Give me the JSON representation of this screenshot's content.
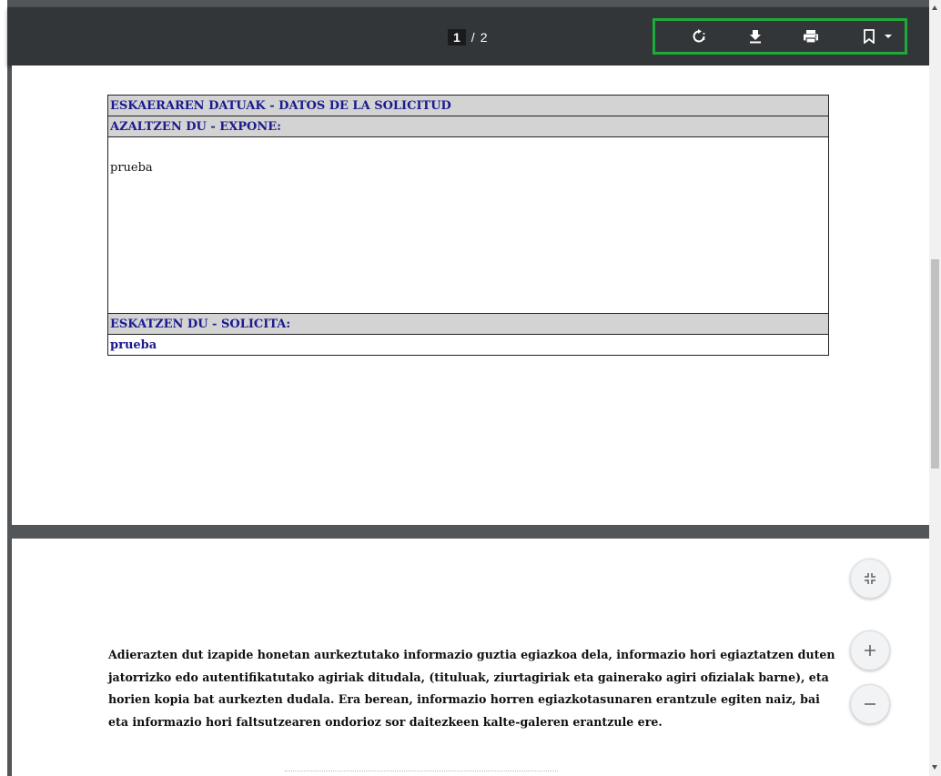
{
  "toolbar": {
    "page_current": "1",
    "page_separator": "/",
    "page_total": "2",
    "icons": {
      "rotate": "rotate-icon",
      "download": "download-icon",
      "print": "print-icon",
      "bookmark": "bookmark-icon",
      "dropdown": "chevron-down-icon"
    },
    "highlight_color": "#1faa3b"
  },
  "page1": {
    "section_header": "ESKAERAREN DATUAK - DATOS DE LA SOLICITUD",
    "expone_header": "AZALTZEN DU - EXPONE:",
    "expone_value": "prueba",
    "solicita_header": "ESKATZEN DU - SOLICITA:",
    "solicita_value": "prueba"
  },
  "page2": {
    "declaration": "Adierazten dut izapide honetan aurkeztutako informazio guztia egiazkoa dela, informazio hori egiaztatzen duten jatorrizko edo autentifikatutako agiriak ditudala, (tituluak, ziurtagiriak eta gainerako agiri ofizialak barne), eta horien kopia bat aurkezten dudala. Era berean, informazio horren egiazkotasunaren erantzule egiten naiz, bai eta informazio hori faltsutzearen ondorioz sor daitezkeen kalte-galeren erantzule ere."
  },
  "fabs": {
    "fit": "fit-to-page-icon",
    "zoom_in": "zoom-in-icon",
    "zoom_out": "zoom-out-icon"
  }
}
